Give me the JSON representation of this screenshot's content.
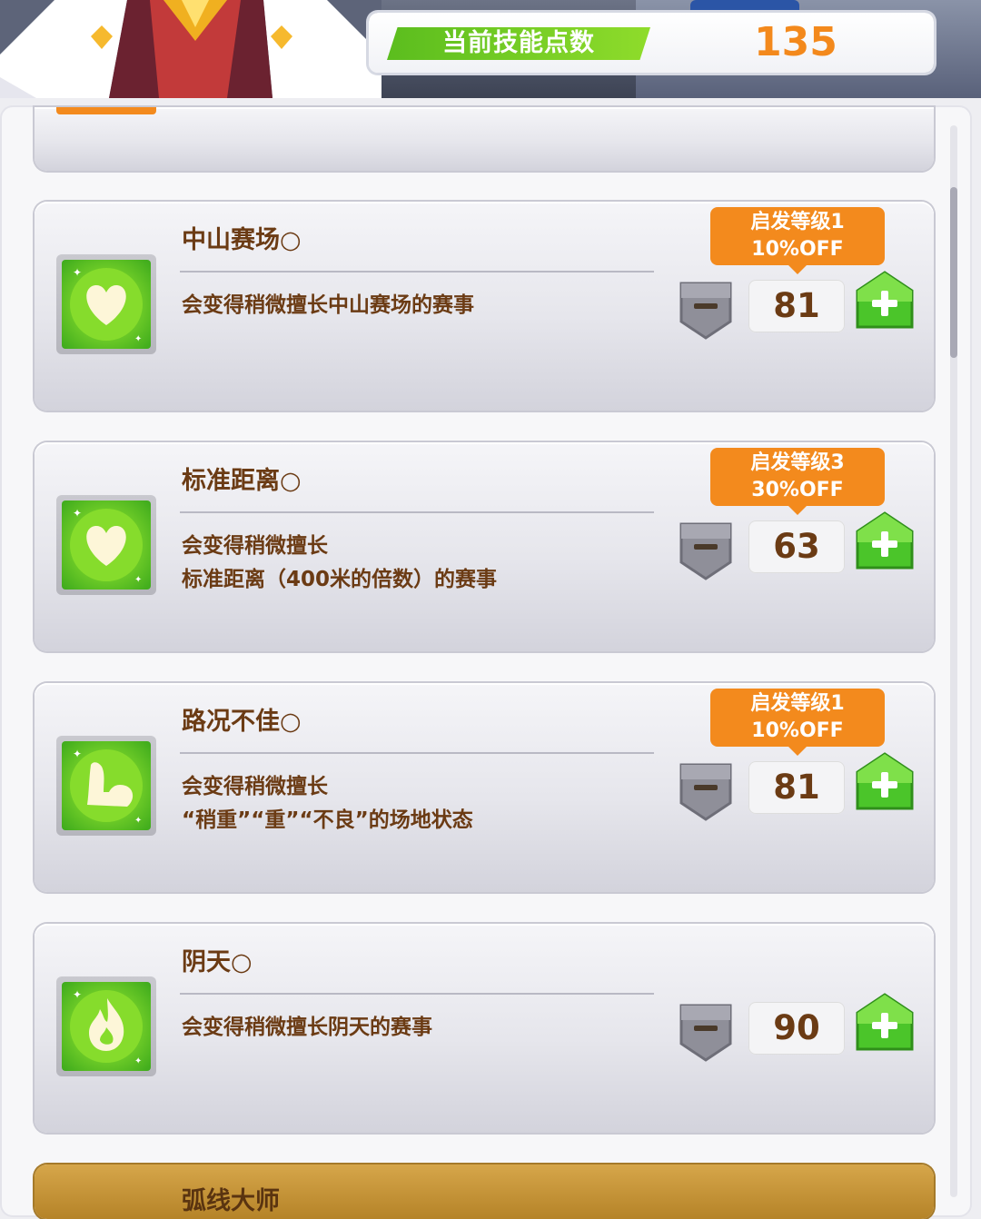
{
  "header": {
    "points_label": "当前技能点数",
    "points_value": "135"
  },
  "skills": [
    {
      "name": "中山赛场○",
      "desc": [
        "会变得稍微擅长中山赛场的赛事"
      ],
      "icon": "heart-icon",
      "discount": {
        "line1": "启发等级1",
        "line2": "10%OFF"
      },
      "cost": "81"
    },
    {
      "name": "标准距离○",
      "desc": [
        "会变得稍微擅长",
        "标准距离（400米的倍数）的赛事"
      ],
      "icon": "heart-icon",
      "discount": {
        "line1": "启发等级3",
        "line2": "30%OFF"
      },
      "cost": "63"
    },
    {
      "name": "路况不佳○",
      "desc": [
        "会变得稍微擅长",
        "“稍重”“重”“不良”的场地状态"
      ],
      "icon": "muscle-icon",
      "discount": {
        "line1": "启发等级1",
        "line2": "10%OFF"
      },
      "cost": "81"
    },
    {
      "name": "阴天○",
      "desc": [
        "会变得稍微擅长阴天的赛事"
      ],
      "icon": "flame-icon",
      "cost": "90"
    }
  ],
  "next_skill": {
    "name": "弧线大师"
  },
  "colors": {
    "accent_orange": "#f38a1d",
    "green": "#5bbd1e",
    "text_brown": "#6b3b14"
  }
}
